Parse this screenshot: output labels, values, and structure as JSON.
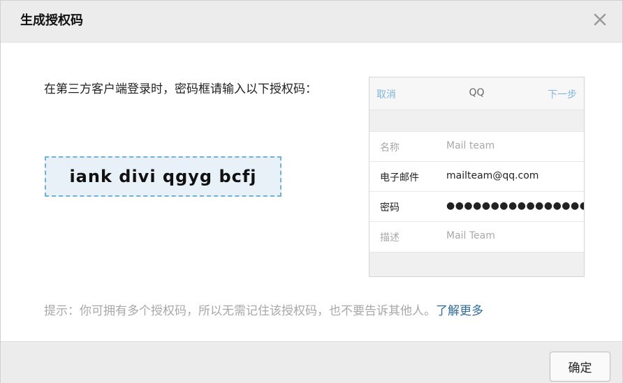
{
  "dialog": {
    "title": "生成授权码",
    "close_icon": "close-icon"
  },
  "instruction": {
    "text": "在第三方客户端登录时，密码框请输入以下授权码："
  },
  "auth_code": "iank divi qgyg bcfj",
  "phone_preview": {
    "cancel_label": "取消",
    "title": "QQ",
    "next_label": "下一步",
    "rows": [
      {
        "label": "名称",
        "value": "Mail team"
      },
      {
        "label": "电子邮件",
        "value": "mailteam@qq.com"
      },
      {
        "label": "密码",
        "value": "●●●●●●●●●●●●●●●●"
      },
      {
        "label": "描述",
        "value": "Mail Team"
      }
    ]
  },
  "tip": {
    "text": "提示：你可拥有多个授权码，所以无需记住该授权码，也不要告诉其他人。",
    "link_label": "了解更多"
  },
  "footer": {
    "ok_label": "确定"
  },
  "colors": {
    "header_bg": "#ececec",
    "code_box_bg": "#e8f1f8",
    "code_box_border": "#6fb2d8",
    "link": "#2f6ca3",
    "ios_blue": "#7fb5e0",
    "muted_text": "#a8a8a8"
  }
}
